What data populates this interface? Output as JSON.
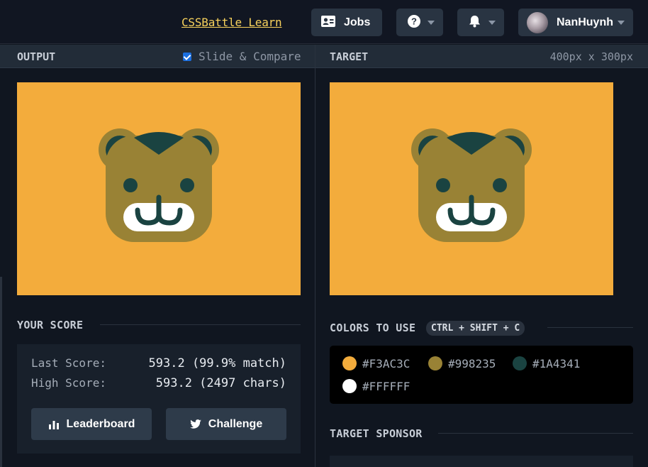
{
  "topbar": {
    "learn_link": "CSSBattle Learn",
    "jobs_label": "Jobs",
    "username": "NanHuynh"
  },
  "output_panel": {
    "title": "OUTPUT",
    "slide_compare_label": "Slide & Compare",
    "slide_compare_checked": true
  },
  "target_panel": {
    "title": "TARGET",
    "dimensions": "400px x 300px"
  },
  "score": {
    "title": "YOUR SCORE",
    "last_label": "Last Score:",
    "last_value": "593.2 (99.9% match)",
    "high_label": "High Score:",
    "high_value": "593.2 (2497 chars)",
    "leaderboard_label": "Leaderboard",
    "challenge_label": "Challenge"
  },
  "colors": {
    "title": "COLORS TO USE",
    "shortcut": "CTRL + SHIFT + C",
    "items": [
      {
        "hex": "#F3AC3C",
        "label": "#F3AC3C"
      },
      {
        "hex": "#998235",
        "label": "#998235"
      },
      {
        "hex": "#1A4341",
        "label": "#1A4341"
      },
      {
        "hex": "#FFFFFF",
        "label": "#FFFFFF"
      }
    ]
  },
  "sponsor": {
    "title": "TARGET SPONSOR"
  },
  "icons": [
    "id-card-icon",
    "help-icon",
    "bell-icon",
    "chevron-down-icon",
    "avatar",
    "bar-chart-icon",
    "twitter-icon"
  ]
}
